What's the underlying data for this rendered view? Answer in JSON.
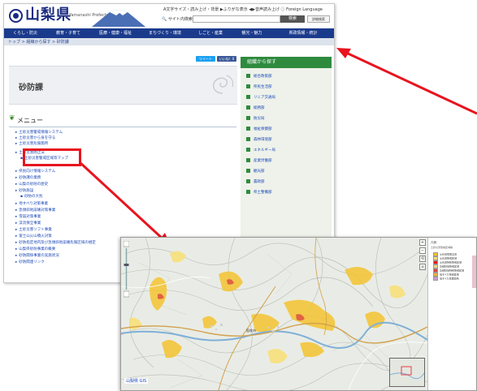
{
  "site": {
    "logo_text": "山梨県",
    "logo_sub": "Yamanashi Prefecture",
    "util_links": "A文字サイズ・読み上げ・背景  ▶ふりがな表示  ◀▶音声読み上げ  ⓘ Foreign Language",
    "search_label": "🔍 サイト内検索",
    "search_placeholder": "",
    "search_button": "検索",
    "detail_search": "詳細検索",
    "nav": [
      "くらし・防災",
      "教育・子育て",
      "医療・健康・福祉",
      "まちづくり・環境",
      "しごと・産業",
      "観光・魅力",
      "県政情報・統計"
    ],
    "breadcrumb": "トップ > 組織から探す > 砂防課",
    "share_label": "ツイート",
    "like_label": "いいね！0",
    "page_title": "砂防課",
    "menu_heading": "メニュー",
    "menu_items": [
      "土砂災害警戒情報システム",
      "土砂災害から身を守る",
      "土砂災害危険箇所",
      "土砂災害防止法",
      "土砂災害警戒区域等マップ",
      "県民向け情報システム",
      "砂防課の業務",
      "山梨の砂防の歴史",
      "砂防施設",
      "砂防の大別",
      "地すべり対策事業",
      "急傾斜地崩壊対策事業",
      "雪崩対策事業",
      "渓流保全事業",
      "土砂災害ソフト事業",
      "富士山火山噴火対策",
      "砂防指定地内及び急傾斜地崩壊危険区域の規定",
      "山梨県砂防事業の概要",
      "砂防関係事業の実施状況",
      "砂防関連リンク"
    ],
    "sidebar_heading": "組織から探す",
    "sidebar_items": [
      "総合政策部",
      "県民生活部",
      "リニア交通局",
      "総務部",
      "防災局",
      "福祉保健部",
      "森林環境部",
      "エネルギー局",
      "産業労働部",
      "観光部",
      "農政部",
      "県土整備部"
    ]
  },
  "map": {
    "brand": "山梨県 GIS",
    "place_label": "笛吹市",
    "legend_title": "凡例",
    "legend_sub": "土砂災害警戒区域等",
    "legend_items": [
      {
        "label": "土石流危険渓流",
        "color": "#f4c430"
      },
      {
        "label": "土石流警戒区域",
        "color": "#f7e07a"
      },
      {
        "label": "土石流特別警戒区域",
        "color": "#e8141e"
      },
      {
        "label": "急傾斜地警戒区域",
        "color": "#f7d68a"
      },
      {
        "label": "急傾斜地特別警戒区域",
        "color": "#d94040"
      },
      {
        "label": "地すべり警戒区域",
        "color": "#f0b040"
      },
      {
        "label": "地すべり危険箇所",
        "color": "#c8a0d0"
      }
    ],
    "tools": [
      "+",
      "−",
      "⟲",
      "⌂"
    ]
  },
  "colors": {
    "nav": "#1a3a8c",
    "accent_green": "#2e8b3e",
    "link": "#1a47b8",
    "highlight": "#e8141e",
    "hazard_yellow": "#f4c430"
  }
}
